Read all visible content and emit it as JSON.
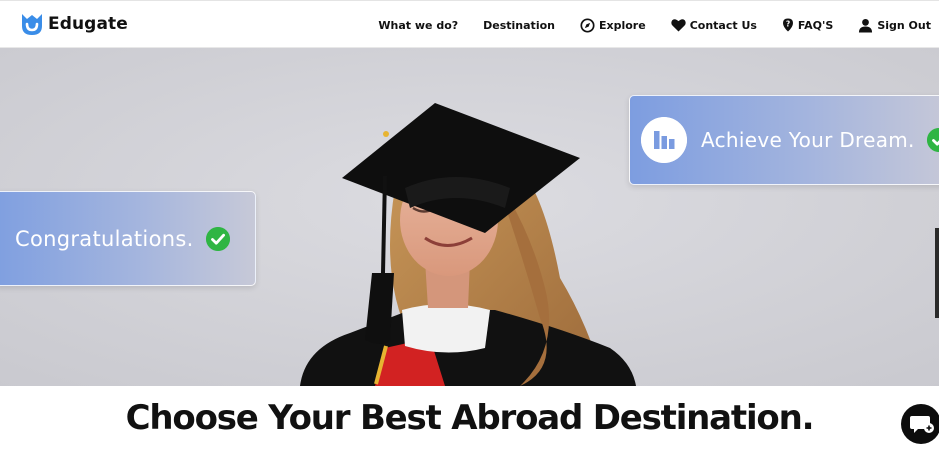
{
  "brand": {
    "name": "Edugate",
    "accent": "#3a8de8"
  },
  "nav": {
    "items": [
      {
        "label": "What we do?",
        "icon": ""
      },
      {
        "label": "Destination",
        "icon": ""
      },
      {
        "label": "Explore",
        "icon": "compass-icon"
      },
      {
        "label": "Contact Us",
        "icon": "heart-icon"
      },
      {
        "label": "FAQ'S",
        "icon": "question-icon"
      },
      {
        "label": "Sign Out",
        "icon": "user-icon"
      }
    ]
  },
  "hero": {
    "card_left": {
      "text": "Congratulations.",
      "icon": "check-icon"
    },
    "card_right": {
      "text": "Achieve Your Dream.",
      "icon": "bar-chart-icon"
    },
    "colors": {
      "background": "#d3d3d8",
      "card": "#8ea7e0",
      "check": "#2fb544"
    }
  },
  "section": {
    "title": "Choose Your Best Abroad Destination."
  },
  "chat": {
    "icon": "chat-icon"
  }
}
